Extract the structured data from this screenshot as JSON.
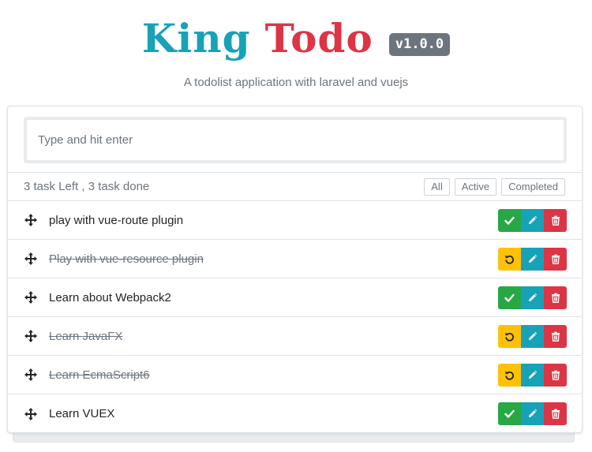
{
  "header": {
    "title_part1": "King",
    "title_part2": "Todo",
    "version": "v1.0.0",
    "subtitle": "A todolist application with laravel and vuejs"
  },
  "input": {
    "placeholder": "Type and hit enter",
    "value": ""
  },
  "status": {
    "summary": "3 task Left , 3 task done"
  },
  "filters": [
    "All",
    "Active",
    "Completed"
  ],
  "tasks": [
    {
      "title": "play with vue-route plugin",
      "done": false
    },
    {
      "title": "Play with vue-resource plugin",
      "done": true
    },
    {
      "title": "Learn about Webpack2",
      "done": false
    },
    {
      "title": "Learn JavaFX",
      "done": true
    },
    {
      "title": "Learn EcmaScript6",
      "done": true
    },
    {
      "title": "Learn VUEX",
      "done": false
    }
  ],
  "icons": {
    "drag": "move-arrows-icon",
    "complete": "check-icon",
    "undo": "undo-icon",
    "edit": "pencil-icon",
    "delete": "trash-icon"
  },
  "colors": {
    "brand_teal": "#17a2b8",
    "brand_red": "#dc3545",
    "success": "#28a745",
    "warning": "#ffc107",
    "muted": "#6c757d"
  }
}
